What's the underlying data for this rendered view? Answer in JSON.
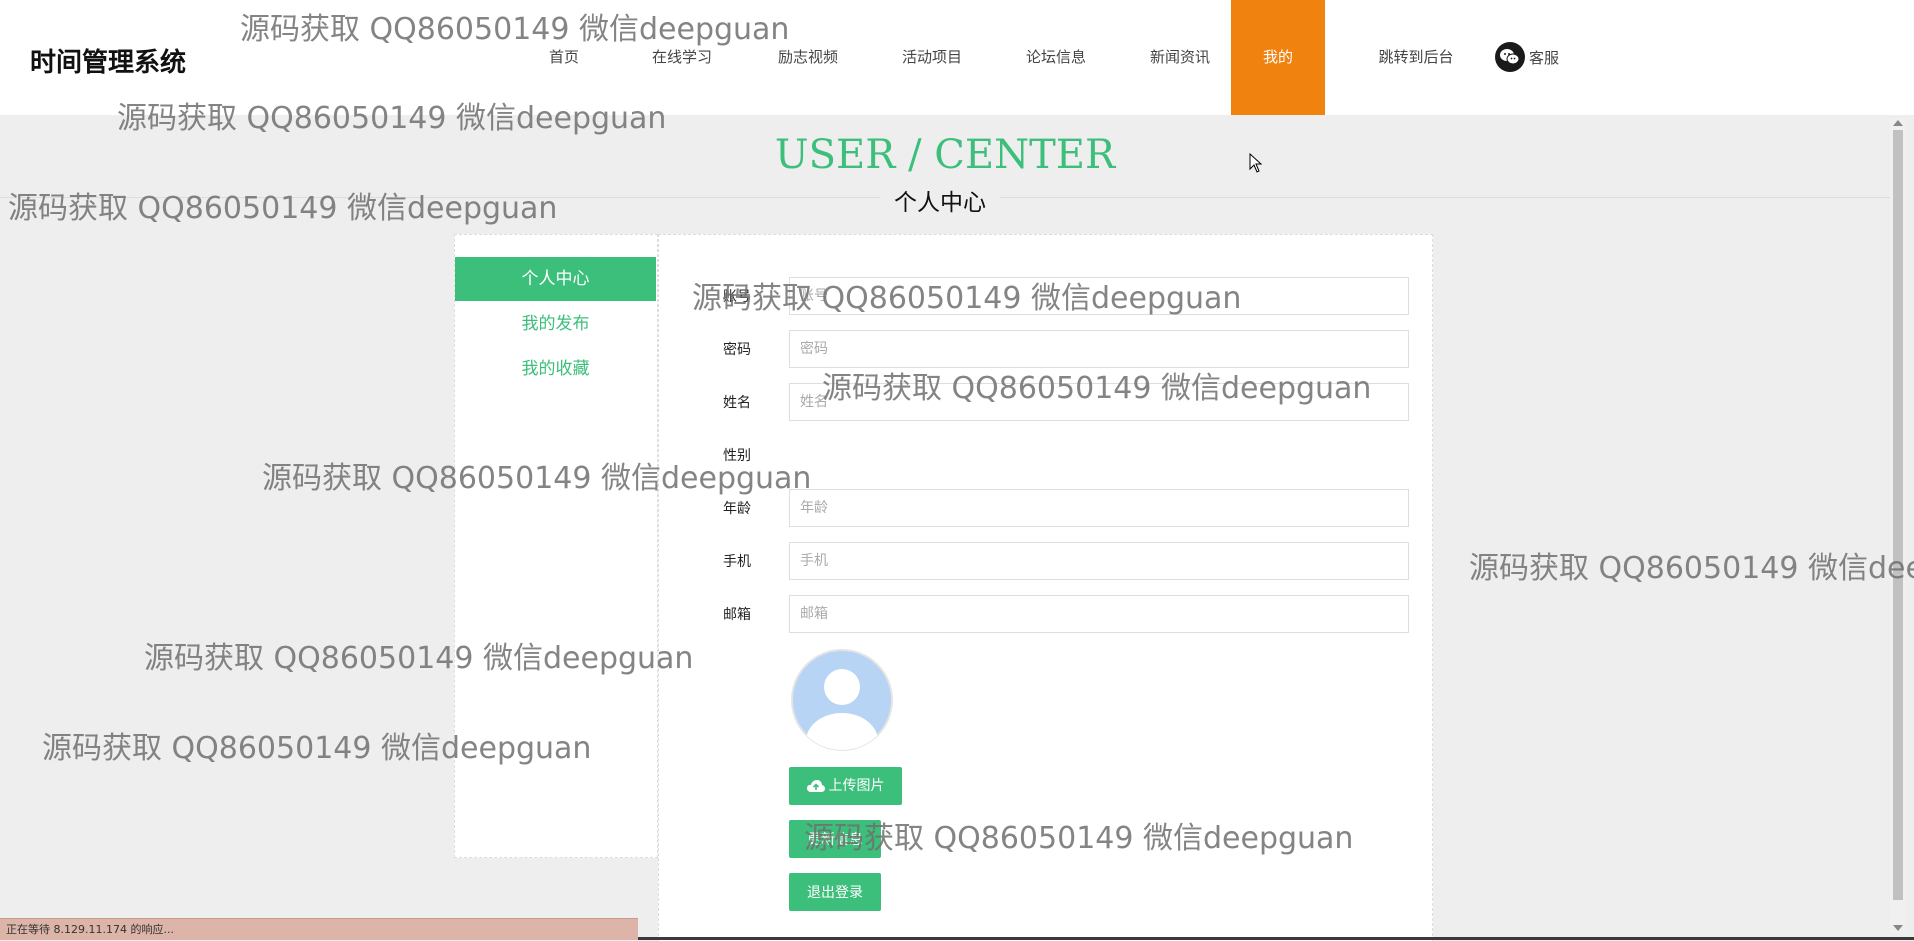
{
  "header": {
    "logo": "时间管理系统",
    "nav": [
      {
        "label": "首页"
      },
      {
        "label": "在线学习"
      },
      {
        "label": "励志视频"
      },
      {
        "label": "活动项目"
      },
      {
        "label": "论坛信息"
      },
      {
        "label": "新闻资讯"
      },
      {
        "label": "我的",
        "active": true
      },
      {
        "label": "跳转到后台"
      }
    ],
    "service_label": "客服",
    "active_color": "#f0820f"
  },
  "page_title": {
    "en": "USER / CENTER",
    "cn": "个人中心",
    "accent_color": "#3cbf7b"
  },
  "side_menu": {
    "items": [
      {
        "label": "个人中心",
        "active": true
      },
      {
        "label": "我的发布"
      },
      {
        "label": "我的收藏"
      }
    ]
  },
  "form": {
    "fields": [
      {
        "label": "账号",
        "placeholder": "账号",
        "value": ""
      },
      {
        "label": "密码",
        "placeholder": "密码",
        "value": ""
      },
      {
        "label": "姓名",
        "placeholder": "姓名",
        "value": ""
      },
      {
        "label": "性别"
      },
      {
        "label": "年龄",
        "placeholder": "年龄",
        "value": ""
      },
      {
        "label": "手机",
        "placeholder": "手机",
        "value": ""
      },
      {
        "label": "邮箱",
        "placeholder": "邮箱",
        "value": ""
      }
    ],
    "upload_label": "上传图片",
    "update_label": "更新信息",
    "logout_label": "退出登录"
  },
  "status_bar": {
    "text": "正在等待 8.129.11.174 的响应..."
  },
  "watermark": {
    "text": "源码获取 QQ86050149 微信deepguan"
  }
}
